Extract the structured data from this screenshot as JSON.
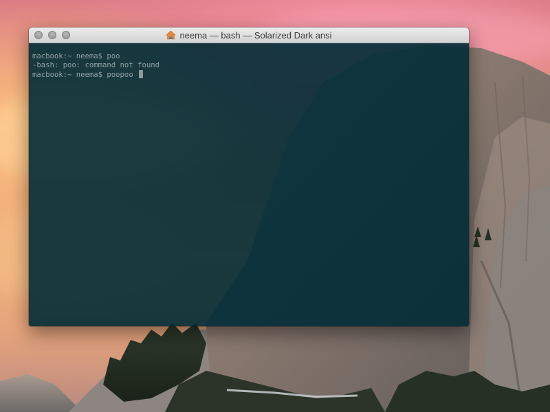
{
  "window": {
    "title": "neema — bash — Solarized Dark ansi",
    "title_icon": "home-folder-icon",
    "buttons": [
      "close-icon",
      "minimize-icon",
      "zoom-icon"
    ]
  },
  "terminal": {
    "lines": [
      "macbook:~ neema$ poo",
      "-bash: poo: command not found",
      "macbook:~ neema$ poopoo "
    ]
  },
  "colors": {
    "terminal_background": "#0f3a43",
    "terminal_text": "#8ea1a3",
    "title_bar": "#dedede",
    "traffic_light": "#9e9e9e",
    "home_icon": "#e38a3a"
  }
}
